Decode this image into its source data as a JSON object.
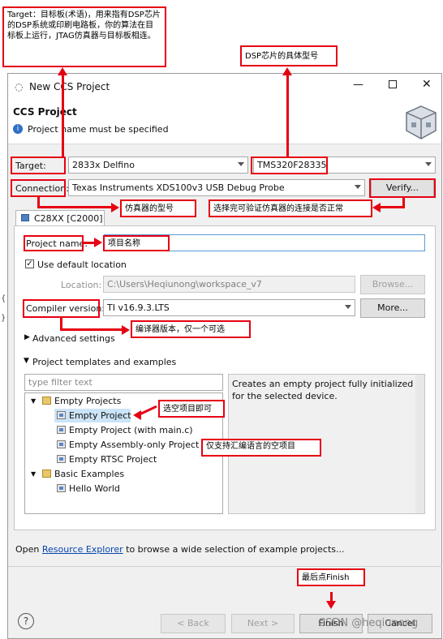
{
  "annotations": {
    "target_note": "Target：目标板(术语)，用来指有DSP芯片的DSP系统或印刷电路板，你的算法在目标板上运行，JTAG仿真器与目标板相连。",
    "dsp_chip_note": "DSP芯片的具体型号",
    "emulator_note": "仿真器的型号",
    "verify_note": "选择完可验证仿真器的连接是否正常",
    "project_name_note": "项目名称",
    "compiler_note": "编译器版本，仅一个可选",
    "empty_project_note": "选空项目即可",
    "assembly_note": "仅支持汇编语言的空项目",
    "finish_note": "最后点Finish"
  },
  "dialog": {
    "title": "New CCS Project",
    "heading": "CCS Project",
    "message": "Project name must be specified"
  },
  "target": {
    "label": "Target:",
    "family": "2833x Delfino",
    "device": "TMS320F28335"
  },
  "connection": {
    "label": "Connection:",
    "value": "Texas Instruments XDS100v3 USB Debug Probe",
    "verify_label": "Verify..."
  },
  "tab": {
    "label": "C28XX [C2000]"
  },
  "project": {
    "name_label": "Project name:",
    "name_value": "",
    "use_default_label": "Use default location",
    "location_label": "Location:",
    "location_value": "C:\\Users\\Heqiunong\\workspace_v7",
    "browse_label": "Browse...",
    "compiler_label": "Compiler version:",
    "compiler_value": "TI v16.9.3.LTS",
    "more_label": "More...",
    "advanced_label": "Advanced settings",
    "templates_label": "Project templates and examples",
    "filter_placeholder": "type filter text"
  },
  "tree": {
    "group1": "Empty Projects",
    "items1": [
      "Empty Project",
      "Empty Project (with main.c)",
      "Empty Assembly-only Project",
      "Empty RTSC Project"
    ],
    "group2": "Basic Examples",
    "items2": [
      "Hello World"
    ]
  },
  "description": "Creates an empty project fully initialized for the selected device.",
  "footer": {
    "open_prefix": "Open",
    "link": "Resource Explorer",
    "open_suffix": "to browse a wide selection of example projects...",
    "back": "< Back",
    "next": "Next >",
    "finish": "Finish",
    "cancel": "Cancel",
    "watermark": "CSDN @heqiunong"
  },
  "colors": {
    "annotation": "#e60012",
    "link": "#0645ad"
  }
}
